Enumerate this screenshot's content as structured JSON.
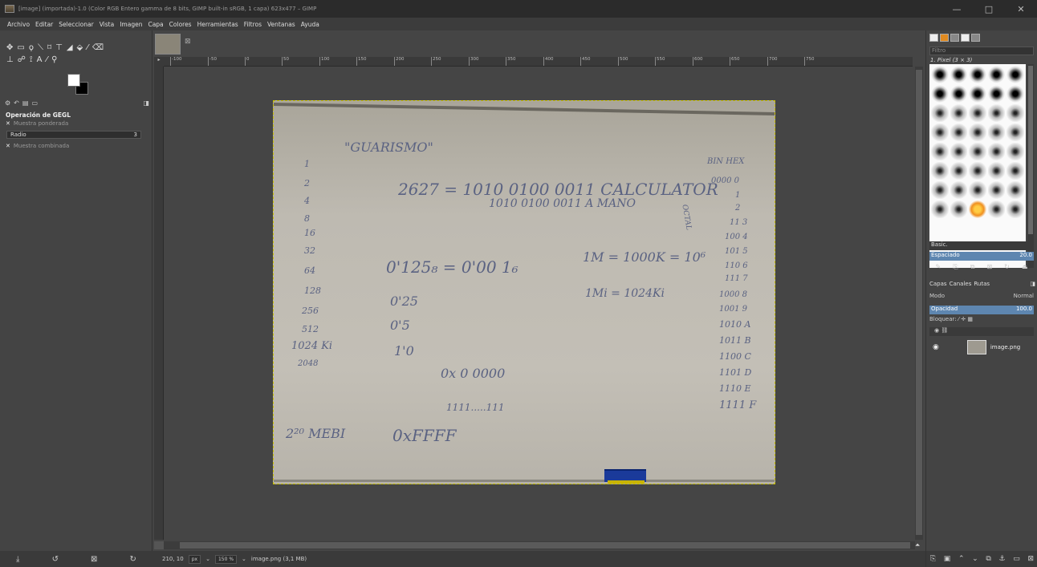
{
  "window": {
    "title": "[image] (importada)-1.0 (Color RGB Entero gamma de 8 bits, GIMP built-in sRGB, 1 capa) 623x477 – GIMP",
    "minimize": "—",
    "maximize": "□",
    "close": "✕"
  },
  "menu": [
    "Archivo",
    "Editar",
    "Seleccionar",
    "Vista",
    "Imagen",
    "Capa",
    "Colores",
    "Herramientas",
    "Filtros",
    "Ventanas",
    "Ayuda"
  ],
  "tool_options": {
    "title": "Operación de GEGL",
    "sampled_average": "Muestra ponderada",
    "radius_label": "Radio",
    "radius_value": "3",
    "sample_merged": "Muestra combinada"
  },
  "ruler_ticks": [
    "-100",
    "-50",
    "0",
    "50",
    "100",
    "150",
    "200",
    "250",
    "300",
    "350",
    "400",
    "450",
    "500",
    "550",
    "600",
    "650",
    "700",
    "750"
  ],
  "status": {
    "coords": "210, 10",
    "unit": "px",
    "zoom": "150 %",
    "file": "image.png (3,1 MB)"
  },
  "whiteboard": {
    "title": "\"GUARISMO\"",
    "equation": "2627 = 1010 0100 0011 CALCULATOR",
    "equation2": "1010 0100 0011  A MANO",
    "fraction": "0'125₈ = 0'00 1₆",
    "mega": "1M = 1000K = 10⁶",
    "mebi_line": "1Mi = 1024Ki",
    "items_25": "0'25",
    "items_5": "0'5",
    "items_0": "1'0",
    "hex": "0x 0 0000",
    "hex2": "1111.....111",
    "hexff": "0xFFFF",
    "mebi": "2²⁰ MEBI",
    "col_left": [
      "1",
      "2",
      "4",
      "8",
      "16",
      "32",
      "64",
      "128",
      "256",
      "512",
      "1024 Ki",
      "2048"
    ],
    "col_right": [
      "0000 0",
      "1",
      "2",
      "11 3",
      "100 4",
      "101 5",
      "110 6",
      "111 7",
      "1000 8",
      "1001 9",
      "1010 A",
      "1011 B",
      "1100 C",
      "1101 D",
      "1110 E",
      "1111 F"
    ],
    "bin_label": "BIN  HEX",
    "octal": "OCTAL"
  },
  "brushes": {
    "filter_placeholder": "Filtro",
    "current": "1. Pixel (3 × 3)",
    "tag": "Basic.",
    "spacing_label": "Espaciado",
    "spacing_value": "20.0"
  },
  "layers": {
    "tab_layers": "Capas",
    "tab_channels": "Canales",
    "tab_paths": "Rutas",
    "mode_label": "Modo",
    "mode_value": "Normal",
    "opacity_label": "Opacidad",
    "opacity_value": "100.0",
    "lock_label": "Bloquear:",
    "layer_name": "image.png"
  }
}
